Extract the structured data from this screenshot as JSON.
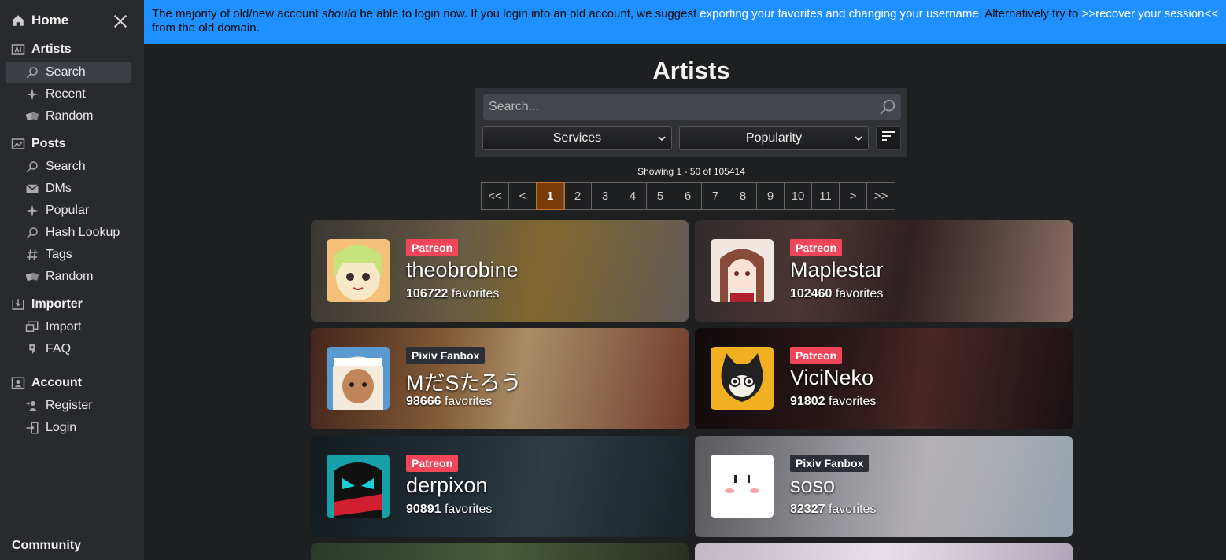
{
  "sidebar": {
    "home": "Home",
    "artists": {
      "title": "Artists",
      "items": [
        "Search",
        "Recent",
        "Random"
      ]
    },
    "posts": {
      "title": "Posts",
      "items": [
        "Search",
        "DMs",
        "Popular",
        "Hash Lookup",
        "Tags",
        "Random"
      ]
    },
    "importer": {
      "title": "Importer",
      "items": [
        "Import",
        "FAQ"
      ]
    },
    "account": {
      "title": "Account",
      "items": [
        "Register",
        "Login"
      ]
    },
    "community": "Community"
  },
  "banner": {
    "t1": "The majority of old/new account ",
    "em": "should",
    "t2": " be able to login now. If you login into an old account, we suggest ",
    "link1": "exporting your favorites and changing your username",
    "t3": ". Alternatively try to ",
    "link2": ">>recover your session<<",
    "t4": " from the old domain."
  },
  "page_title": "Artists",
  "search": {
    "placeholder": "Search..."
  },
  "filters": {
    "service": "Services",
    "sort": "Popularity"
  },
  "showing": "Showing 1 - 50 of 105414",
  "pagination": [
    "<<",
    "<",
    "1",
    "2",
    "3",
    "4",
    "5",
    "6",
    "7",
    "8",
    "9",
    "10",
    "11",
    ">",
    ">>"
  ],
  "favorites_suffix": "favorites",
  "artists": [
    {
      "name": "theobrobine",
      "service": "Patreon",
      "favorites": "106722"
    },
    {
      "name": "Maplestar",
      "service": "Patreon",
      "favorites": "102460"
    },
    {
      "name": "MだSたろう",
      "service": "Pixiv Fanbox",
      "favorites": "98666"
    },
    {
      "name": "ViciNeko",
      "service": "Patreon",
      "favorites": "91802"
    },
    {
      "name": "derpixon",
      "service": "Patreon",
      "favorites": "90891"
    },
    {
      "name": "soso",
      "service": "Pixiv Fanbox",
      "favorites": "82327"
    }
  ],
  "colors": {
    "banner": "#1e90ff",
    "patreon_badge": "#f1465a",
    "fanbox_badge": "#2c3036",
    "current_page": "#7a3b0a"
  }
}
